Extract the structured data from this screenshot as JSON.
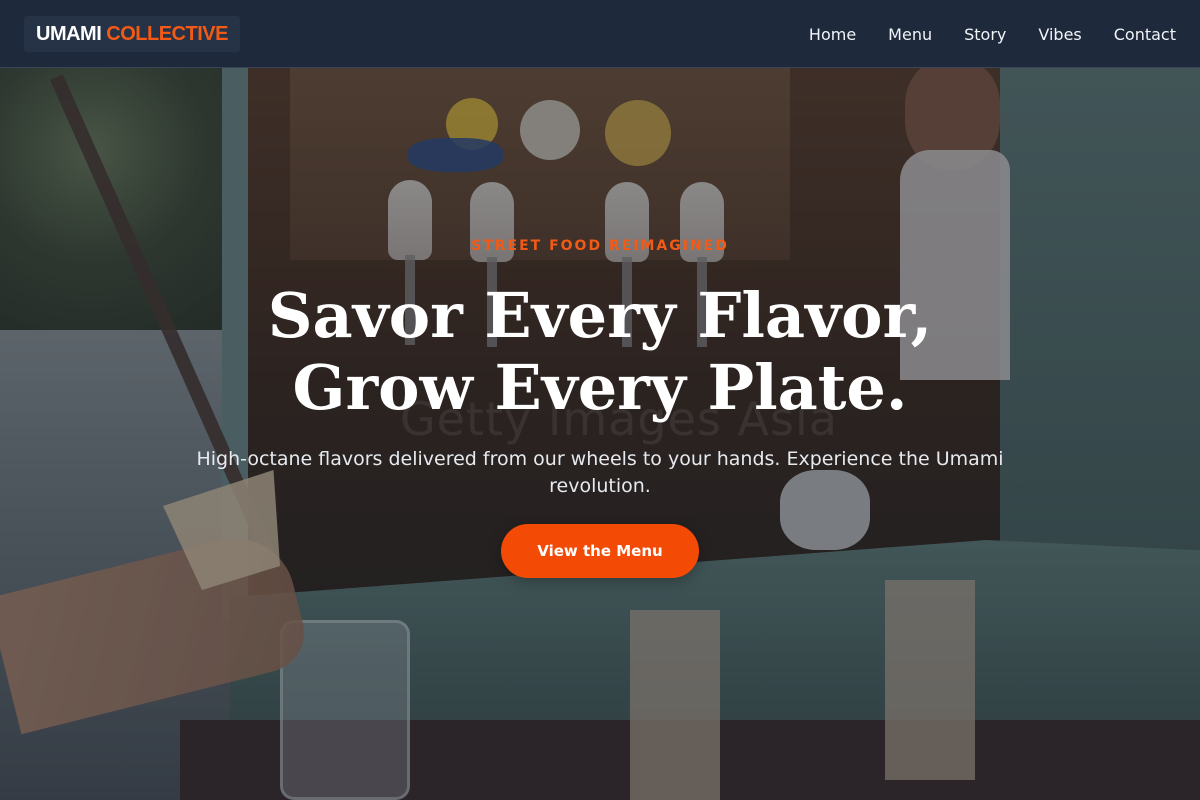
{
  "brand": {
    "part1": "UMAMI",
    "part2": "COLLECTIVE"
  },
  "nav": {
    "items": [
      {
        "label": "Home"
      },
      {
        "label": "Menu"
      },
      {
        "label": "Story"
      },
      {
        "label": "Vibes"
      },
      {
        "label": "Contact"
      }
    ]
  },
  "hero": {
    "eyebrow": "STREET FOOD REIMAGINED",
    "headline_line1": "Savor Every Flavor,",
    "headline_line2": "Grow Every Plate.",
    "subtext": "High-octane flavors delivered from our wheels to your hands. Experience the Umami revolution.",
    "cta_label": "View the Menu",
    "background_image": "food-truck-photo",
    "photo_watermark": "Getty Images Asia"
  },
  "colors": {
    "accent": "#f35a16",
    "cta": "#f34a06",
    "navbar": "#1e293b",
    "text": "#ffffff"
  }
}
